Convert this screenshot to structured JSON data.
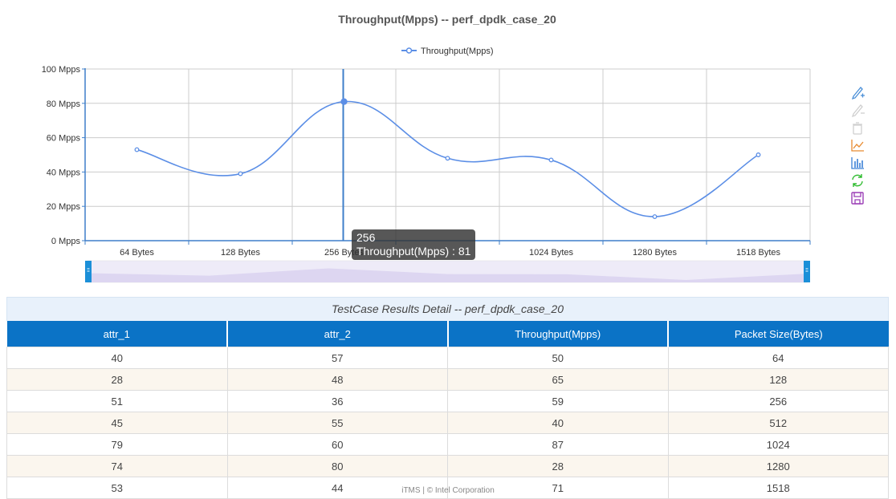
{
  "chart_data": {
    "type": "line",
    "title": "Throughput(Mpps) -- perf_dpdk_case_20",
    "categories": [
      "64 Bytes",
      "128 Bytes",
      "256 Bytes",
      "512 Bytes",
      "1024 Bytes",
      "1280 Bytes",
      "1518 Bytes"
    ],
    "categories_visible": [
      "64 Bytes",
      "128 Bytes",
      "256 Bytes",
      "",
      "1024 Bytes",
      "1280 Bytes",
      "1518 Bytes"
    ],
    "series": [
      {
        "name": "Throughput(Mpps)",
        "values": [
          53,
          39,
          81,
          48,
          47,
          14,
          50
        ],
        "color": "#5b8ee6"
      }
    ],
    "y_ticks": [
      "0 Mpps",
      "20 Mpps",
      "40 Mpps",
      "60 Mpps",
      "80 Mpps",
      "100 Mpps"
    ],
    "ylim": [
      0,
      100
    ],
    "grid": true,
    "legend_position": "top-center"
  },
  "tooltip": {
    "header": "256",
    "line": "Throughput(Mpps) : 81"
  },
  "toolbox": [
    {
      "name": "zoom-icon",
      "color": "#4a8fd8"
    },
    {
      "name": "zoom-reset-icon",
      "color": "#cfcfcf"
    },
    {
      "name": "restore-icon",
      "color": "#cfcfcf"
    },
    {
      "name": "line-chart-icon",
      "color": "#e88a30"
    },
    {
      "name": "bar-chart-icon",
      "color": "#3b80d6"
    },
    {
      "name": "refresh-icon",
      "color": "#2dbb2d"
    },
    {
      "name": "save-icon",
      "color": "#9b3fb6"
    }
  ],
  "table": {
    "caption": "TestCase Results Detail -- perf_dpdk_case_20",
    "headers": [
      "attr_1",
      "attr_2",
      "Throughput(Mpps)",
      "Packet Size(Bytes)"
    ],
    "rows": [
      [
        "40",
        "57",
        "50",
        "64"
      ],
      [
        "28",
        "48",
        "65",
        "128"
      ],
      [
        "51",
        "36",
        "59",
        "256"
      ],
      [
        "45",
        "55",
        "40",
        "512"
      ],
      [
        "79",
        "60",
        "87",
        "1024"
      ],
      [
        "74",
        "80",
        "28",
        "1280"
      ],
      [
        "53",
        "44",
        "71",
        "1518"
      ]
    ]
  },
  "footer": "iTMS | © Intel Corporation"
}
